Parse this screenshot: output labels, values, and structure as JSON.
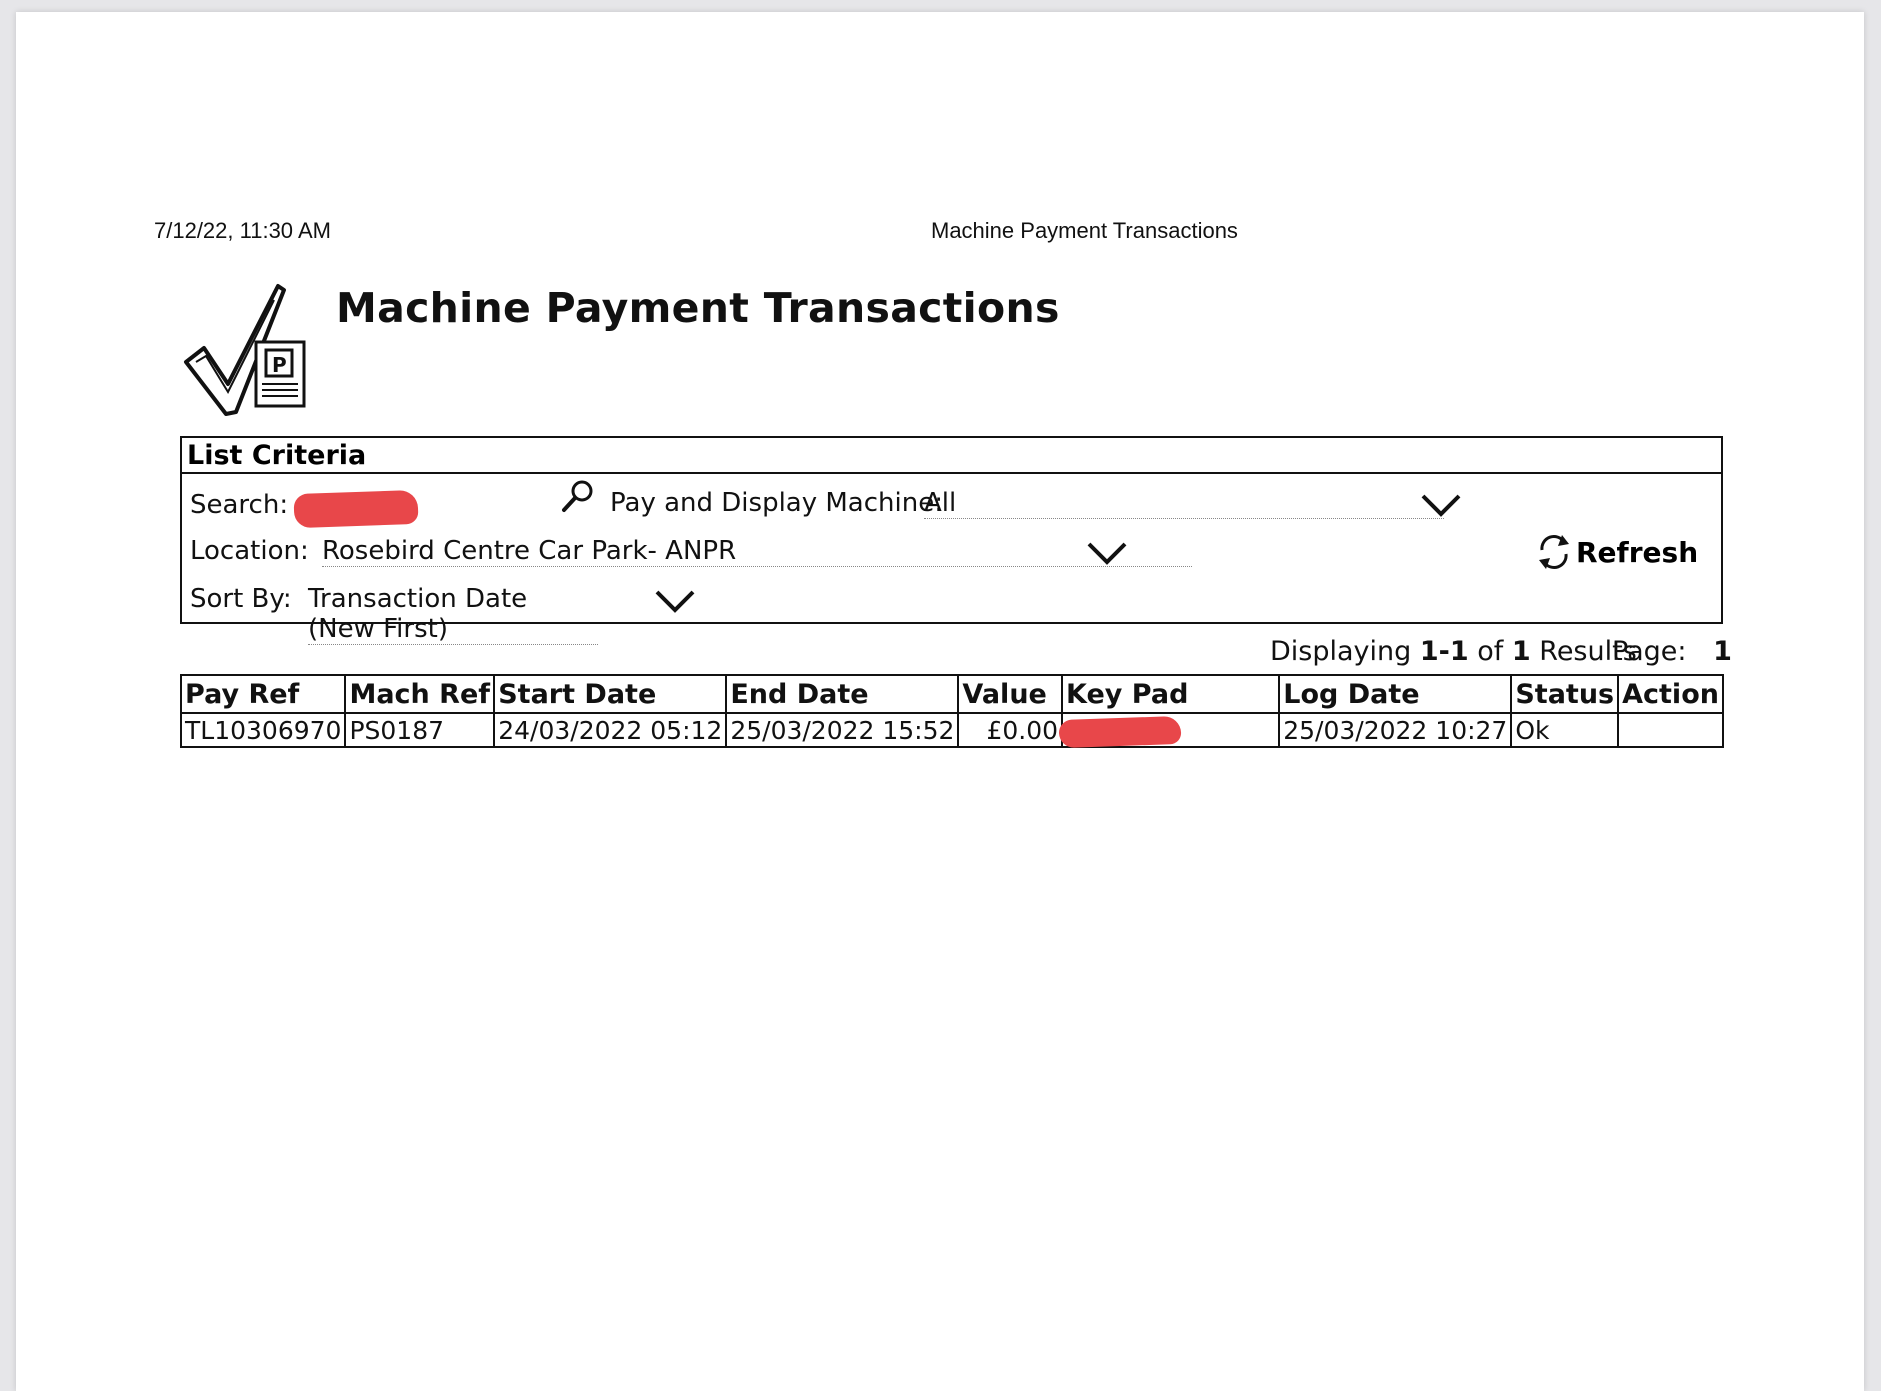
{
  "print_header": {
    "date": "7/12/22, 11:30 AM",
    "title": "Machine Payment Transactions"
  },
  "page_title": "Machine Payment Transactions",
  "criteria": {
    "heading": "List Criteria",
    "search_label": "Search:",
    "machine_label": "Pay and Display Machine:",
    "machine_value": "All",
    "location_label": "Location:",
    "location_value": "Rosebird Centre Car Park- ANPR",
    "sort_label": "Sort By:",
    "sort_value": "Transaction Date (New First)",
    "refresh_label": "Refresh"
  },
  "results": {
    "displaying_prefix": "Displaying",
    "range": "1-1",
    "of_word": "of",
    "total": "1",
    "results_word": "Results",
    "page_label": "Page:",
    "page_number": "1"
  },
  "table": {
    "headers": [
      "Pay Ref",
      "Mach Ref",
      "Start Date",
      "End Date",
      "Value",
      "Key Pad",
      "Log Date",
      "Status",
      "Action"
    ],
    "rows": [
      {
        "pay_ref": "TL10306970",
        "mach_ref": "PS0187",
        "start_date": "24/03/2022 05:12",
        "end_date": "25/03/2022 15:52",
        "value": "£0.00",
        "key_pad": "",
        "log_date": "25/03/2022 10:27",
        "status": "Ok",
        "action": ""
      }
    ]
  },
  "colors": {
    "redaction": "#e8474a",
    "text": "#111111"
  }
}
